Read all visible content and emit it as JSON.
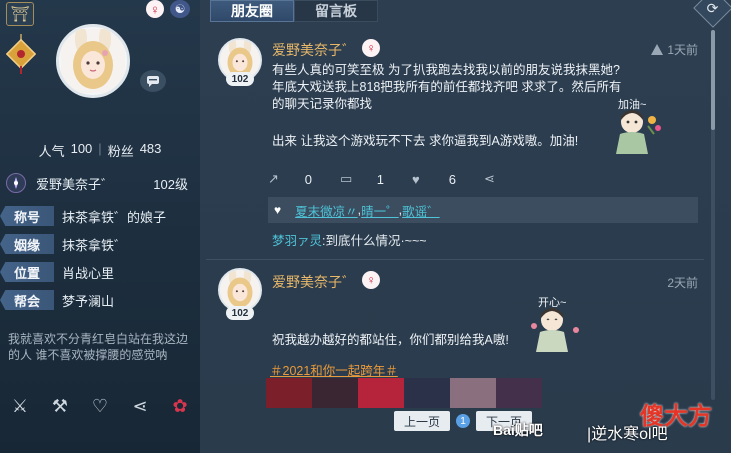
{
  "left_panel": {
    "stats": {
      "popularity_label": "人气",
      "popularity": "100",
      "fans_label": "粉丝",
      "fans": "483"
    },
    "player_name": "爱野美奈子゛",
    "level": "102级",
    "info": [
      {
        "tag": "称号",
        "value": "抹茶拿铁゛的娘子"
      },
      {
        "tag": "姻缘",
        "value": "抹茶拿铁゛"
      },
      {
        "tag": "位置",
        "value": "肖战心里"
      },
      {
        "tag": "帮会",
        "value": "梦予澜山"
      }
    ],
    "signature": "我就喜欢不分青红皂白站在我这边的人 谁不喜欢被撑腰的感觉呐"
  },
  "tabs": [
    {
      "label": "朋友圈",
      "active": true
    },
    {
      "label": "留言板",
      "active": false
    }
  ],
  "posts": [
    {
      "author": "爱野美奈子゛",
      "level": "102",
      "time": "1天前",
      "text": "有些人真的可笑至极  为了扒我跑去找我以前的朋友说我抹黑她? 年底大戏送我上818把我所有的前任都找齐吧  求求了。然后所有的聊天记录你都找",
      "text_cont": "出来  让我这个游戏玩不下去  求你逼我到A游戏嗷。加油!",
      "sticker_label": "加油~",
      "shares": "0",
      "comments": "1",
      "likes": "6",
      "liked_by": [
        "夏末微凉〃",
        "晴一゜",
        "歌谣゛"
      ],
      "comment_user": "梦羽ァ灵",
      "comment_text": ":到底什么情况·~~~"
    },
    {
      "author": "爱野美奈子゛",
      "level": "102",
      "time": "2天前",
      "text": "祝我越办越好的都站住，你们都别给我A嗷!",
      "sticker_label": "开心~",
      "hashtag": "＃2021和你一起跨年＃"
    }
  ],
  "pager": {
    "prev": "上一页",
    "page": "1",
    "next": "下一页"
  },
  "watermarks": {
    "baidu": "Bai贴吧",
    "bar": "|逆水寒ol吧",
    "site": "傻大方"
  },
  "colors": {
    "accent_orange": "#e8b86a",
    "link_cyan": "#4fc3d8",
    "female_red": "#c9213c"
  }
}
